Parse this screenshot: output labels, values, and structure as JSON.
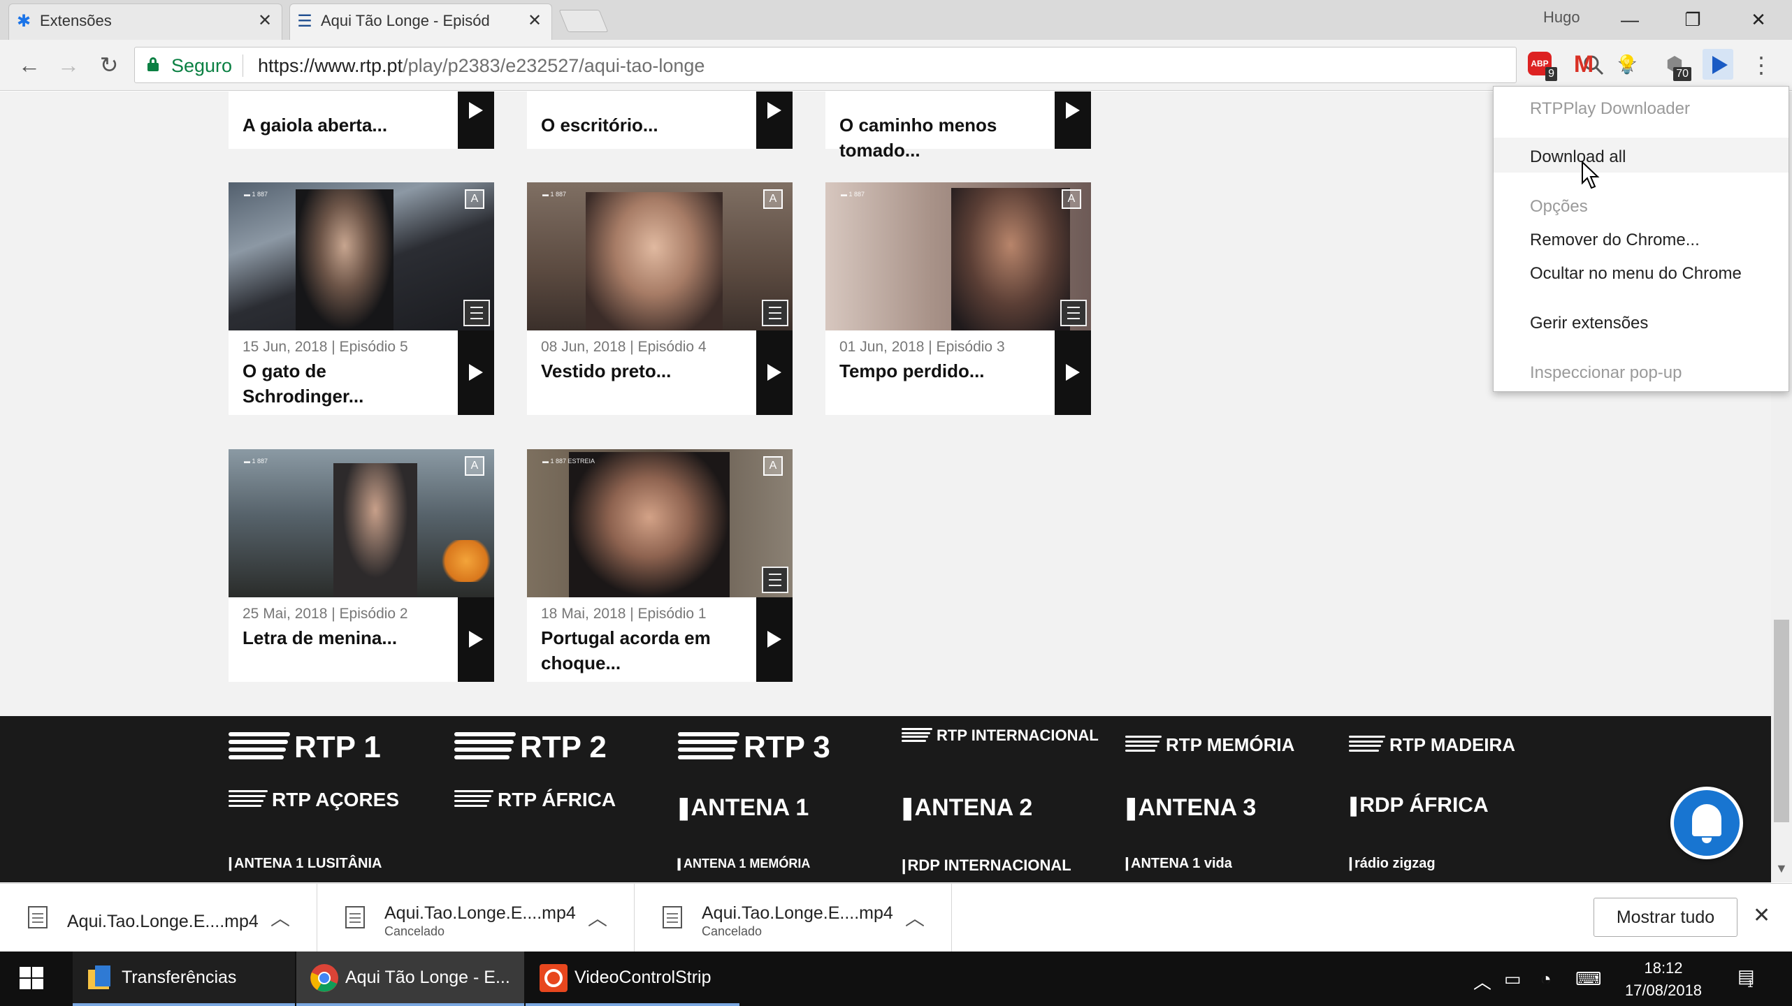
{
  "browser": {
    "tabs": [
      {
        "label": "Extensões",
        "icon": "puzzle-icon",
        "close": "✕"
      },
      {
        "label": "Aqui Tão Longe - Episód",
        "icon": "rtp-favicon",
        "close": "✕"
      }
    ],
    "user": "Hugo",
    "window_controls": {
      "minimize": "—",
      "restore": "❐",
      "close": "✕"
    },
    "security_label": "Seguro",
    "url_host": "https://www.rtp.pt",
    "url_path": "/play/p2383/e232527/aqui-tao-longe",
    "extensions": [
      {
        "name": "adblock-icon",
        "label": "ABP",
        "badge": "9"
      },
      {
        "name": "gmail-icon",
        "label": "M",
        "badge": ""
      },
      {
        "name": "keep-icon",
        "label": "💡",
        "badge": ""
      },
      {
        "name": "shield-ext-icon",
        "label": "⬢",
        "badge": "70"
      },
      {
        "name": "rtpplay-downloader-icon",
        "label": "",
        "badge": ""
      }
    ]
  },
  "episodes_top": [
    {
      "title": "A gaiola aberta..."
    },
    {
      "title": "O escritório..."
    },
    {
      "title": "O caminho menos tomado..."
    }
  ],
  "episodes": [
    {
      "meta": "15 Jun, 2018 | Episódio 5",
      "title": "O gato de Schrodinger...",
      "thumb_tag": "▬ 1 887"
    },
    {
      "meta": "08 Jun, 2018 | Episódio 4",
      "title": "Vestido preto...",
      "thumb_tag": "▬ 1 887"
    },
    {
      "meta": "01 Jun, 2018 | Episódio 3",
      "title": "Tempo perdido...",
      "thumb_tag": "▬ 1 887"
    },
    {
      "meta": "25 Mai, 2018 | Episódio 2",
      "title": "Letra de menina...",
      "thumb_tag": "▬ 1 887"
    },
    {
      "meta": "18 Mai, 2018 | Episódio 1",
      "title": "Portugal acorda em choque...",
      "thumb_tag": "▬ 1 887 ESTREIA"
    }
  ],
  "footer_logos": [
    {
      "name": "rtp1-logo",
      "text": "RTP 1"
    },
    {
      "name": "rtp2-logo",
      "text": "RTP 2"
    },
    {
      "name": "rtp3-logo",
      "text": "RTP 3"
    },
    {
      "name": "rtp-internacional-logo",
      "text": "RTP INTERNACIONAL"
    },
    {
      "name": "rtp-memoria-logo",
      "text": "RTP MEMÓRIA"
    },
    {
      "name": "rtp-madeira-logo",
      "text": "RTP MADEIRA"
    },
    {
      "name": "rtp-acores-logo",
      "text": "RTP AÇORES"
    },
    {
      "name": "rtp-africa-logo",
      "text": "RTP ÁFRICA"
    },
    {
      "name": "antena1-logo",
      "text": "ANTENA 1"
    },
    {
      "name": "antena2-logo",
      "text": "ANTENA 2"
    },
    {
      "name": "antena3-logo",
      "text": "ANTENA 3"
    },
    {
      "name": "rdp-africa-logo",
      "text": "RDP ÁFRICA"
    },
    {
      "name": "antena1-lusitania-logo",
      "text": "ANTENA 1 LUSITÂNIA"
    },
    {
      "name": "antena1-memoria-logo",
      "text": "ANTENA 1 MEMÓRIA"
    },
    {
      "name": "rdp-internacional-logo",
      "text": "RDP INTERNACIONAL"
    },
    {
      "name": "antena1-vida-logo",
      "text": "ANTENA 1 vida"
    },
    {
      "name": "radio-zigzag-logo",
      "text": "rádio zigzag"
    }
  ],
  "extension_menu": {
    "header": "RTPPlay Downloader",
    "download_all": "Download all",
    "options": "Opções",
    "remove": "Remover do Chrome...",
    "hide": "Ocultar no menu do Chrome",
    "manage": "Gerir extensões",
    "inspect": "Inspeccionar pop-up"
  },
  "downloads": [
    {
      "name": "Aqui.Tao.Longe.E....mp4",
      "status": ""
    },
    {
      "name": "Aqui.Tao.Longe.E....mp4",
      "status": "Cancelado"
    },
    {
      "name": "Aqui.Tao.Longe.E....mp4",
      "status": "Cancelado"
    }
  ],
  "download_shelf": {
    "show_all": "Mostrar tudo",
    "close": "✕"
  },
  "taskbar": {
    "items": [
      {
        "label": "Transferências",
        "icon": "file-explorer-icon"
      },
      {
        "label": "Aqui Tão Longe - E...",
        "icon": "chrome-icon"
      },
      {
        "label": "VideoControlStrip",
        "icon": "videocontrolstrip-icon"
      }
    ],
    "time": "18:12",
    "date": "17/08/2018",
    "notifications": "1"
  },
  "colors": {
    "secure_green": "#0b8043",
    "footer_bg": "#1a1a1a",
    "bell_blue": "#1875d1",
    "taskbar_bg": "#101010"
  }
}
